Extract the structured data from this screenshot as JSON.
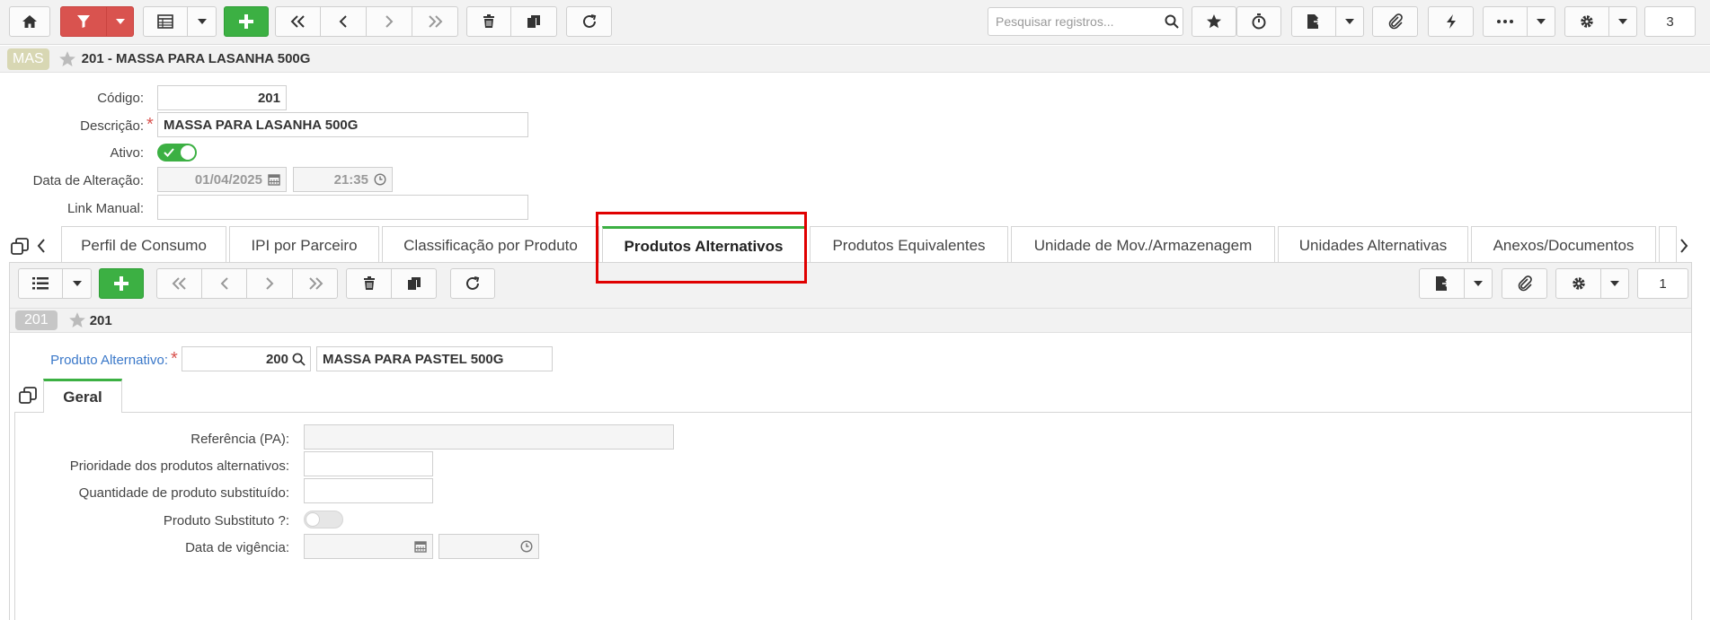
{
  "toolbar": {
    "search_placeholder": "Pesquisar registros...",
    "counter": "3"
  },
  "record": {
    "badge": "MAS",
    "title": "201 - MASSA PARA LASANHA 500G"
  },
  "form": {
    "codigo_label": "Código:",
    "codigo_value": "201",
    "descricao_label": "Descrição:",
    "descricao_value": "MASSA PARA LASANHA 500G",
    "ativo_label": "Ativo:",
    "data_alteracao_label": "Data de Alteração:",
    "data_alteracao_date": "01/04/2025",
    "data_alteracao_time": "21:35",
    "link_manual_label": "Link Manual:",
    "link_manual_value": ""
  },
  "tabs": [
    {
      "label": "Perfil de Consumo"
    },
    {
      "label": "IPI por Parceiro"
    },
    {
      "label": "Classificação por Produto"
    },
    {
      "label": "Produtos Alternativos",
      "active": true
    },
    {
      "label": "Produtos Equivalentes"
    },
    {
      "label": "Unidade de Mov./Armazenagem"
    },
    {
      "label": "Unidades Alternativas"
    },
    {
      "label": "Anexos/Documentos"
    }
  ],
  "inner": {
    "counter": "1",
    "badge": "201",
    "title": "201",
    "produto_alt_label": "Produto Alternativo:",
    "produto_alt_code": "200",
    "produto_alt_desc": "MASSA PARA PASTEL 500G",
    "subtab_label": "Geral",
    "referencia_label": "Referência (PA):",
    "prioridade_label": "Prioridade dos produtos alternativos:",
    "quantidade_label": "Quantidade de produto substituído:",
    "substituto_label": "Produto Substituto ?:",
    "vigencia_label": "Data de vigência:"
  },
  "colors": {
    "accent_green": "#3cb043",
    "filter_red": "#d9534f",
    "highlight_red": "#e00000",
    "link_blue": "#3a78c9"
  }
}
